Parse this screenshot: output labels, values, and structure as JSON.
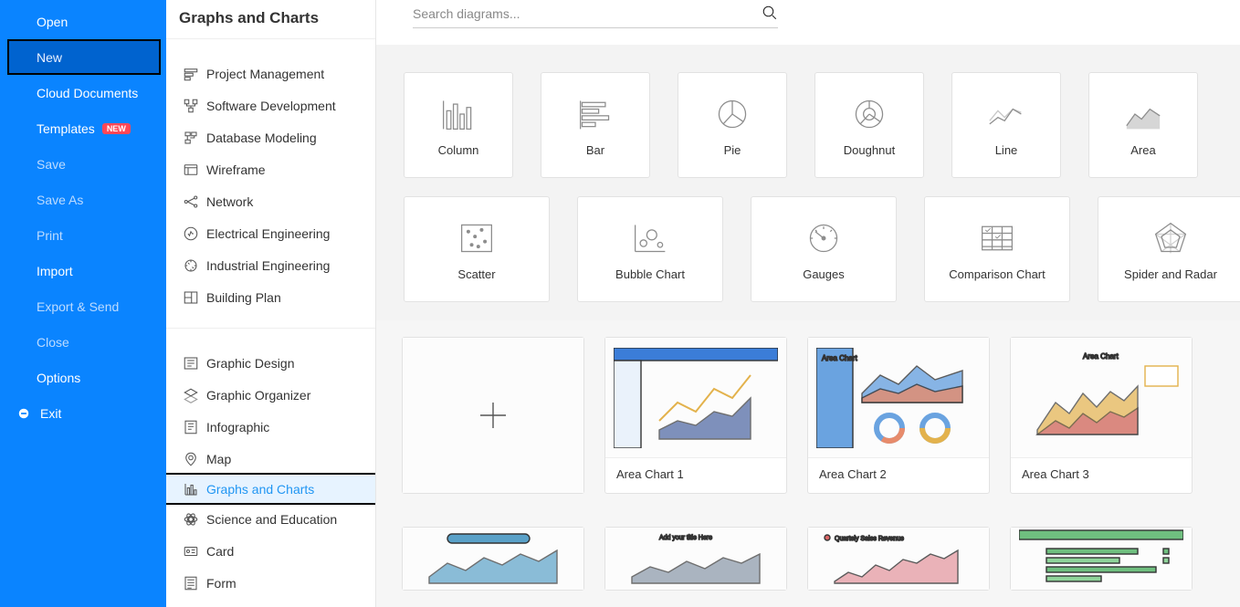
{
  "leftnav": {
    "items": [
      {
        "label": "Open",
        "style": "bright"
      },
      {
        "label": "New",
        "style": "selected"
      },
      {
        "label": "Cloud Documents",
        "style": "bright"
      },
      {
        "label": "Templates",
        "style": "bright",
        "badge": "NEW"
      },
      {
        "label": "Save",
        "style": "dim"
      },
      {
        "label": "Save As",
        "style": "dim"
      },
      {
        "label": "Print",
        "style": "dim"
      },
      {
        "label": "Import",
        "style": "bright"
      },
      {
        "label": "Export & Send",
        "style": "dim"
      },
      {
        "label": "Close",
        "style": "dim"
      },
      {
        "label": "Options",
        "style": "bright"
      },
      {
        "label": "Exit",
        "style": "bright",
        "icon": "minus-circle"
      }
    ]
  },
  "categories": {
    "title": "Graphs and Charts",
    "group1": [
      {
        "label": "Project Management",
        "icon": "pm"
      },
      {
        "label": "Software Development",
        "icon": "sd"
      },
      {
        "label": "Database Modeling",
        "icon": "db"
      },
      {
        "label": "Wireframe",
        "icon": "wf"
      },
      {
        "label": "Network",
        "icon": "nw"
      },
      {
        "label": "Electrical Engineering",
        "icon": "ee"
      },
      {
        "label": "Industrial Engineering",
        "icon": "ie"
      },
      {
        "label": "Building Plan",
        "icon": "bp"
      }
    ],
    "group2": [
      {
        "label": "Graphic Design",
        "icon": "gd"
      },
      {
        "label": "Graphic Organizer",
        "icon": "go"
      },
      {
        "label": "Infographic",
        "icon": "ig"
      },
      {
        "label": "Map",
        "icon": "mp"
      },
      {
        "label": "Graphs and Charts",
        "icon": "gc",
        "active": true
      },
      {
        "label": "Science and Education",
        "icon": "se"
      },
      {
        "label": "Card",
        "icon": "cd"
      },
      {
        "label": "Form",
        "icon": "fm"
      }
    ]
  },
  "search": {
    "placeholder": "Search diagrams..."
  },
  "chart_types": [
    {
      "label": "Column",
      "icon": "column"
    },
    {
      "label": "Bar",
      "icon": "bar"
    },
    {
      "label": "Pie",
      "icon": "pie"
    },
    {
      "label": "Doughnut",
      "icon": "doughnut"
    },
    {
      "label": "Line",
      "icon": "line"
    },
    {
      "label": "Area",
      "icon": "area"
    },
    {
      "label": "Scatter",
      "icon": "scatter"
    },
    {
      "label": "Bubble Chart",
      "icon": "bubble"
    },
    {
      "label": "Gauges",
      "icon": "gauge"
    },
    {
      "label": "Comparison Chart",
      "icon": "comparison"
    },
    {
      "label": "Spider and Radar",
      "icon": "radar"
    }
  ],
  "templates": [
    {
      "label": "",
      "new": true
    },
    {
      "label": "Area Chart 1"
    },
    {
      "label": "Area Chart 2"
    },
    {
      "label": "Area Chart 3"
    }
  ]
}
